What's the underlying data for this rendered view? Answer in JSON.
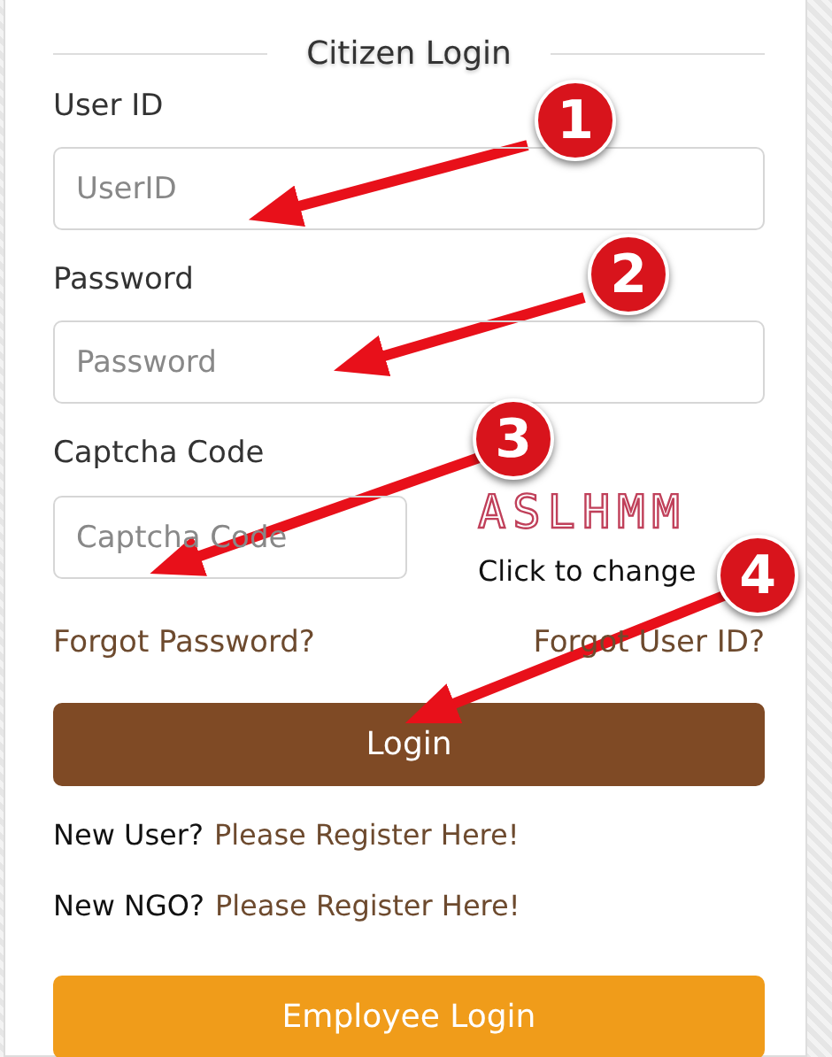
{
  "title": "Citizen Login",
  "fields": [
    {
      "label": "User ID",
      "placeholder": "UserID"
    },
    {
      "label": "Password",
      "placeholder": "Password"
    }
  ],
  "captcha": {
    "label": "Captcha Code",
    "placeholder": "Captcha Code",
    "code": "ASLHMM",
    "refresh": "Click to change"
  },
  "forgot_links": [
    "Forgot Password?",
    "Forgot User ID?"
  ],
  "login_button": "Login",
  "register_lines": [
    {
      "prefix": "New User?",
      "link": "Please Register Here!"
    },
    {
      "prefix": "New NGO?",
      "link": "Please Register Here!"
    }
  ],
  "employee_button": "Employee Login",
  "annotations": [
    {
      "number": "1"
    },
    {
      "number": "2"
    },
    {
      "number": "3"
    },
    {
      "number": "4"
    }
  ]
}
